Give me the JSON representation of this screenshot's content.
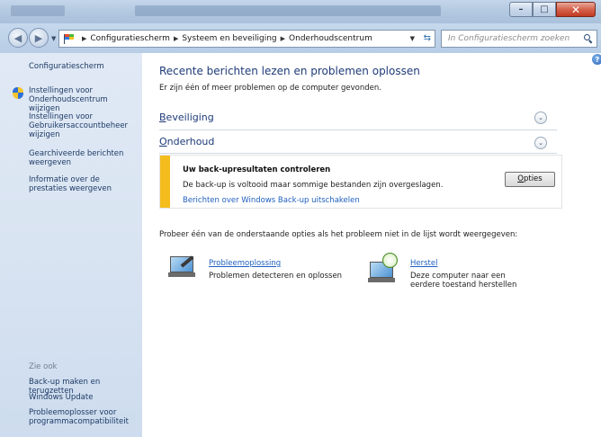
{
  "window": {
    "close_glyph": "✕",
    "minimize_glyph": "–",
    "maximize_glyph": "□"
  },
  "address": {
    "back_glyph": "◀",
    "forward_glyph": "▶",
    "breadcrumbs": [
      "Configuratiescherm",
      "Systeem en beveiliging",
      "Onderhoudscentrum"
    ],
    "search_placeholder": "In Configuratiescherm zoeken"
  },
  "sidebar": {
    "home": "Configuratiescherm",
    "items": [
      "Instellingen voor Onderhoudscentrum wijzigen",
      "Instellingen voor Gebruikersaccountbeheer wijzigen",
      "Gearchiveerde berichten weergeven",
      "Informatie over de prestaties weergeven"
    ],
    "see_also_label": "Zie ook",
    "see_also": [
      "Back-up maken en terugzetten",
      "Windows Update",
      "Probleemoplosser voor programmacompatibiliteit"
    ]
  },
  "main": {
    "title": "Recente berichten lezen en problemen oplossen",
    "subtitle": "Er zijn één of meer problemen op de computer gevonden.",
    "sections": [
      {
        "accesskey": "B",
        "rest": "eveiliging"
      },
      {
        "accesskey": "O",
        "rest": "nderhoud"
      }
    ],
    "alert": {
      "title": "Uw back-upresultaten controleren",
      "text": "De back-up is voltooid maar sommige bestanden zijn overgeslagen.",
      "link": "Berichten over Windows Back-up uitschakelen",
      "button_accesskey": "O",
      "button_rest": "pties",
      "color": "#f4bd1d"
    },
    "help_text": "Probeer één van de onderstaande opties als het probleem niet in de lijst wordt weergegeven:",
    "tools": [
      {
        "title": "Probleemoplossing",
        "desc": "Problemen detecteren en oplossen"
      },
      {
        "title": "Herstel",
        "desc": "Deze computer naar een eerdere toestand herstellen"
      }
    ]
  },
  "colors": {
    "link": "#1f5fbf",
    "heading": "#1e3b78",
    "sidebar_bg": "#d9e4f2"
  }
}
